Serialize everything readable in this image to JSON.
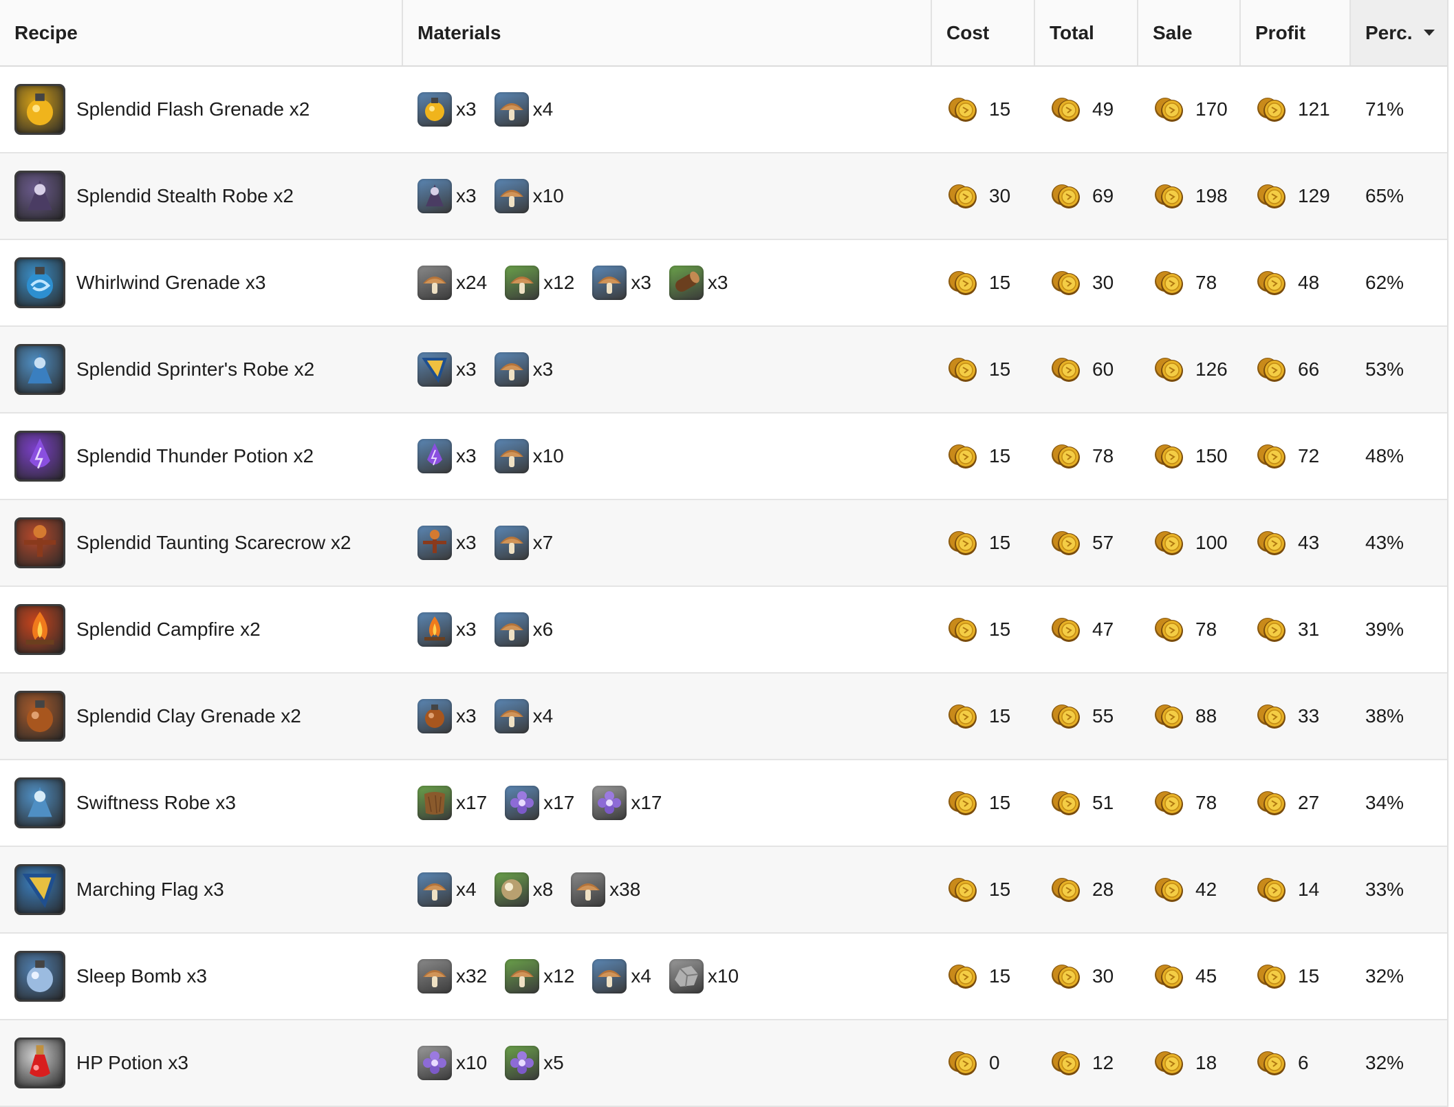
{
  "headers": {
    "recipe": "Recipe",
    "materials": "Materials",
    "cost": "Cost",
    "total": "Total",
    "sale": "Sale",
    "profit": "Profit",
    "perc": "Perc."
  },
  "rows": [
    {
      "name": "Splendid Flash Grenade x2",
      "icon": "flash-grenade-icon",
      "icon_color": "#d4a017",
      "materials": [
        {
          "icon": "flash-grenade-icon",
          "color": "#5b87b5",
          "qty": "x3"
        },
        {
          "icon": "mushroom-icon",
          "color": "#5b87b5",
          "qty": "x4"
        }
      ],
      "cost": "15",
      "total": "49",
      "sale": "170",
      "profit": "121",
      "perc": "71%"
    },
    {
      "name": "Splendid Stealth Robe x2",
      "icon": "stealth-robe-icon",
      "icon_color": "#6a5a8c",
      "materials": [
        {
          "icon": "stealth-robe-icon",
          "color": "#5b87b5",
          "qty": "x3"
        },
        {
          "icon": "mushroom-icon",
          "color": "#5b87b5",
          "qty": "x10"
        }
      ],
      "cost": "30",
      "total": "69",
      "sale": "198",
      "profit": "129",
      "perc": "65%"
    },
    {
      "name": "Whirlwind Grenade x3",
      "icon": "whirlwind-grenade-icon",
      "icon_color": "#3a8fc9",
      "materials": [
        {
          "icon": "mushroom-icon",
          "color": "#8a8a8a",
          "qty": "x24"
        },
        {
          "icon": "mushroom-icon",
          "color": "#6aa14a",
          "qty": "x12"
        },
        {
          "icon": "mushroom-icon",
          "color": "#5b87b5",
          "qty": "x3"
        },
        {
          "icon": "log-icon",
          "color": "#6aa14a",
          "qty": "x3"
        }
      ],
      "cost": "15",
      "total": "30",
      "sale": "78",
      "profit": "48",
      "perc": "62%"
    },
    {
      "name": "Splendid Sprinter's Robe x2",
      "icon": "sprinter-robe-icon",
      "icon_color": "#4f8fc4",
      "materials": [
        {
          "icon": "flag-icon",
          "color": "#5b87b5",
          "qty": "x3"
        },
        {
          "icon": "mushroom-icon",
          "color": "#5b87b5",
          "qty": "x3"
        }
      ],
      "cost": "15",
      "total": "60",
      "sale": "126",
      "profit": "66",
      "perc": "53%"
    },
    {
      "name": "Splendid Thunder Potion x2",
      "icon": "thunder-potion-icon",
      "icon_color": "#7a3fc7",
      "materials": [
        {
          "icon": "thunder-potion-icon",
          "color": "#5b87b5",
          "qty": "x3"
        },
        {
          "icon": "mushroom-icon",
          "color": "#5b87b5",
          "qty": "x10"
        }
      ],
      "cost": "15",
      "total": "78",
      "sale": "150",
      "profit": "72",
      "perc": "48%"
    },
    {
      "name": "Splendid Taunting Scarecrow x2",
      "icon": "scarecrow-icon",
      "icon_color": "#b5482a",
      "materials": [
        {
          "icon": "scarecrow-icon",
          "color": "#5b87b5",
          "qty": "x3"
        },
        {
          "icon": "mushroom-icon",
          "color": "#5b87b5",
          "qty": "x7"
        }
      ],
      "cost": "15",
      "total": "57",
      "sale": "100",
      "profit": "43",
      "perc": "43%"
    },
    {
      "name": "Splendid Campfire x2",
      "icon": "campfire-icon",
      "icon_color": "#c8441c",
      "materials": [
        {
          "icon": "campfire-icon",
          "color": "#5b87b5",
          "qty": "x3"
        },
        {
          "icon": "mushroom-icon",
          "color": "#5b87b5",
          "qty": "x6"
        }
      ],
      "cost": "15",
      "total": "47",
      "sale": "78",
      "profit": "31",
      "perc": "39%"
    },
    {
      "name": "Splendid Clay Grenade x2",
      "icon": "clay-grenade-icon",
      "icon_color": "#a85a2a",
      "materials": [
        {
          "icon": "clay-grenade-icon",
          "color": "#5b87b5",
          "qty": "x3"
        },
        {
          "icon": "mushroom-icon",
          "color": "#5b87b5",
          "qty": "x4"
        }
      ],
      "cost": "15",
      "total": "55",
      "sale": "88",
      "profit": "33",
      "perc": "38%"
    },
    {
      "name": "Swiftness Robe x3",
      "icon": "swiftness-robe-icon",
      "icon_color": "#4f8fc4",
      "materials": [
        {
          "icon": "leather-icon",
          "color": "#6aa14a",
          "qty": "x17"
        },
        {
          "icon": "flower-icon",
          "color": "#5b87b5",
          "qty": "x17"
        },
        {
          "icon": "flower-icon",
          "color": "#9a9a9a",
          "qty": "x17"
        }
      ],
      "cost": "15",
      "total": "51",
      "sale": "78",
      "profit": "27",
      "perc": "34%"
    },
    {
      "name": "Marching Flag x3",
      "icon": "marching-flag-icon",
      "icon_color": "#3a7fc0",
      "materials": [
        {
          "icon": "mushroom-icon",
          "color": "#5b87b5",
          "qty": "x4"
        },
        {
          "icon": "orb-icon",
          "color": "#6aa14a",
          "qty": "x8"
        },
        {
          "icon": "mushroom-icon",
          "color": "#8a8a8a",
          "qty": "x38"
        }
      ],
      "cost": "15",
      "total": "28",
      "sale": "42",
      "profit": "14",
      "perc": "33%"
    },
    {
      "name": "Sleep Bomb x3",
      "icon": "sleep-bomb-icon",
      "icon_color": "#4f7fb0",
      "materials": [
        {
          "icon": "mushroom-icon",
          "color": "#8a8a8a",
          "qty": "x32"
        },
        {
          "icon": "mushroom-icon",
          "color": "#6aa14a",
          "qty": "x12"
        },
        {
          "icon": "mushroom-icon",
          "color": "#5b87b5",
          "qty": "x4"
        },
        {
          "icon": "ore-icon",
          "color": "#9a9a9a",
          "qty": "x10"
        }
      ],
      "cost": "15",
      "total": "30",
      "sale": "45",
      "profit": "15",
      "perc": "32%"
    },
    {
      "name": "HP Potion x3",
      "icon": "hp-potion-icon",
      "icon_color": "#d0d0d0",
      "materials": [
        {
          "icon": "flower-icon",
          "color": "#9a9a9a",
          "qty": "x10"
        },
        {
          "icon": "flower-icon",
          "color": "#6aa14a",
          "qty": "x5"
        }
      ],
      "cost": "0",
      "total": "12",
      "sale": "18",
      "profit": "6",
      "perc": "32%"
    }
  ]
}
